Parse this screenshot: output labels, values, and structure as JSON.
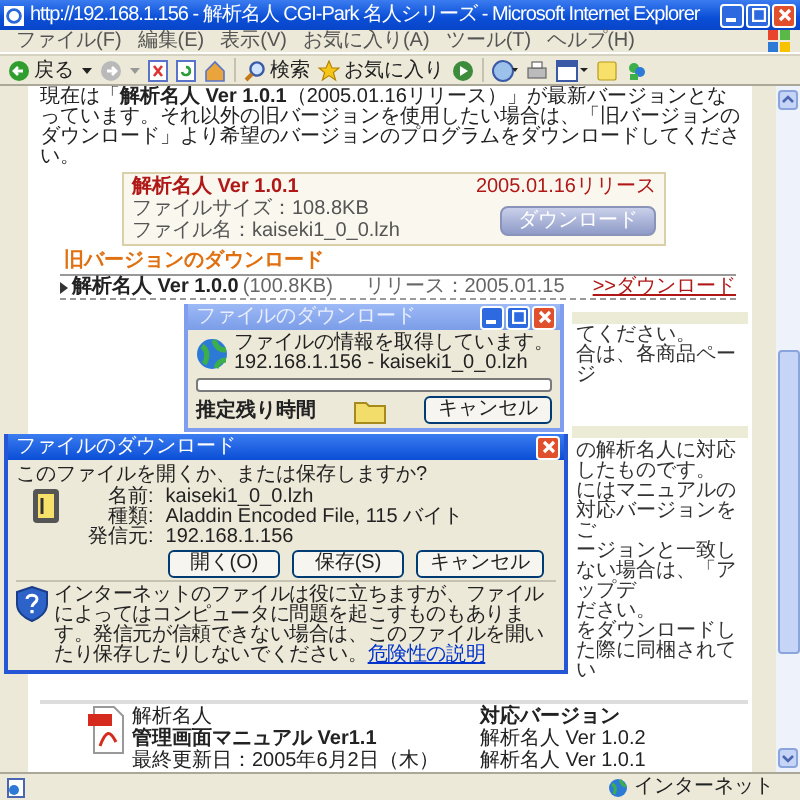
{
  "window": {
    "title": "http://192.168.1.156 - 解析名人 CGI-Park 名人シリーズ - Microsoft Internet Explorer"
  },
  "menu": [
    "ファイル(F)",
    "編集(E)",
    "表示(V)",
    "お気に入り(A)",
    "ツール(T)",
    "ヘルプ(H)"
  ],
  "toolbar": {
    "back_label": "戻る",
    "search_label": "検索",
    "favorites_label": "お気に入り"
  },
  "page": {
    "intro": "現在は「**解析名人 Ver 1.0.1**（2005.01.16リリース）」が最新バージョンとなっています。それ以外の旧バージョンを使用したい場合は、「旧バージョンのダウンロード」より希望のバージョンのプログラムをダウンロードしてください。",
    "latest": {
      "title": "解析名人 Ver 1.0.1",
      "release": "2005.01.16リリース",
      "size": "ファイルサイズ：108.8KB",
      "filename": "ファイル名：kaiseki1_0_0.lzh",
      "button": "ダウンロード"
    },
    "old_heading": "旧バージョンのダウンロード",
    "old_versions": [
      {
        "name": "解析名人 Ver 1.0.0",
        "size": "(100.8KB)",
        "release": "リリース：2005.01.15",
        "link": ">>ダウンロード"
      }
    ],
    "covered_text_1": [
      "てください。",
      "合は、各商品ページ"
    ],
    "covered_text_2": [
      "の解析名人に対応したものです。",
      "にはマニュアルの対応バージョンをご",
      "ージョンと一致しない場合は、「アップデ",
      "ださい。",
      "をダウンロードした際に同梱されてい"
    ],
    "manual": {
      "product": "解析名人",
      "title": "管理画面マニュアル Ver1.1",
      "updated": "最終更新日：2005年6月2日（木）",
      "versions_heading": "対応バージョン",
      "versions": [
        "解析名人 Ver 1.0.2",
        "解析名人 Ver 1.0.1"
      ]
    }
  },
  "status_bar": {
    "zone": "インターネット"
  },
  "progress_dialog": {
    "title": "ファイルのダウンロード",
    "message": "ファイルの情報を取得しています。",
    "source": "192.168.1.156 - kaiseki1_0_0.lzh",
    "progress": {
      "level": 0
    },
    "time_left_label": "推定残り時間",
    "cancel": "キャンセル"
  },
  "open_dialog": {
    "title": "ファイルのダウンロード",
    "question": "このファイルを開くか、または保存しますか?",
    "fields": [
      {
        "label": "名前:",
        "value": "kaiseki1_0_0.lzh"
      },
      {
        "label": "種類:",
        "value": "Aladdin Encoded File, 115 バイト"
      },
      {
        "label": "発信元:",
        "value": "192.168.1.156"
      }
    ],
    "buttons": [
      "開く(O)",
      "保存(S)",
      "キャンセル"
    ],
    "warning": "インターネットのファイルは役に立ちますが、ファイルによってはコンピュータに問題を起こすものもあります。発信元が信頼できない場合は、このファイルを開いたり保存したりしないでください。",
    "warning_link": "危険性の説明"
  }
}
